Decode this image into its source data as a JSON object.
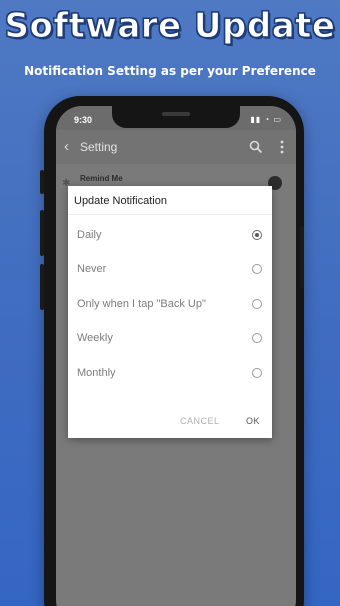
{
  "promo": {
    "headline": "Software Update",
    "subline": "Notification Setting as per your Preference"
  },
  "status_bar": {
    "time": "9:30",
    "icons": "▮▮ ◔ ▭"
  },
  "toolbar": {
    "back_icon": "‹",
    "title": "Setting"
  },
  "settings_row": {
    "label": "Remind Me"
  },
  "dialog": {
    "title": "Update Notification",
    "options": [
      {
        "label": "Daily",
        "selected": true
      },
      {
        "label": "Never",
        "selected": false
      },
      {
        "label": "Only when I tap \"Back Up\"",
        "selected": false
      },
      {
        "label": "Weekly",
        "selected": false
      },
      {
        "label": "Monthly",
        "selected": false
      }
    ],
    "cancel_label": "CANCEL",
    "ok_label": "OK"
  },
  "colors": {
    "background": "#3f6cc0",
    "scrim": "#7a7a7a",
    "dialog": "#ffffff"
  }
}
